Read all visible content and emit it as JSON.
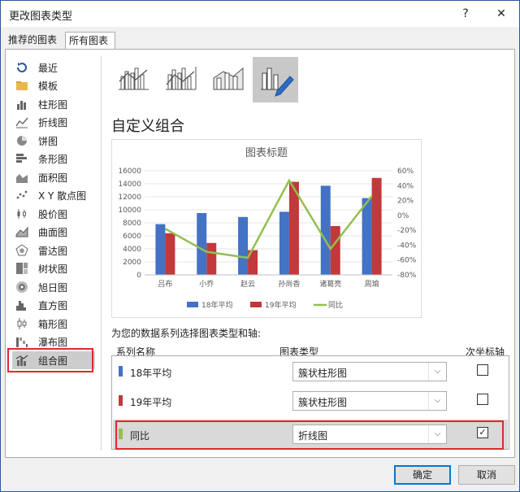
{
  "dialog": {
    "title": "更改图表类型",
    "help": "?",
    "close": "✕"
  },
  "tabs": [
    {
      "label": "推荐的图表"
    },
    {
      "label": "所有图表"
    }
  ],
  "sidebar": {
    "items": [
      {
        "label": "最近",
        "icon": "recent-icon"
      },
      {
        "label": "模板",
        "icon": "folder-icon"
      },
      {
        "label": "柱形图",
        "icon": "column-chart-icon"
      },
      {
        "label": "折线图",
        "icon": "line-chart-icon"
      },
      {
        "label": "饼图",
        "icon": "pie-chart-icon"
      },
      {
        "label": "条形图",
        "icon": "bar-chart-icon"
      },
      {
        "label": "面积图",
        "icon": "area-chart-icon"
      },
      {
        "label": "X Y 散点图",
        "icon": "scatter-chart-icon"
      },
      {
        "label": "股价图",
        "icon": "stock-chart-icon"
      },
      {
        "label": "曲面图",
        "icon": "surface-chart-icon"
      },
      {
        "label": "雷达图",
        "icon": "radar-chart-icon"
      },
      {
        "label": "树状图",
        "icon": "treemap-chart-icon"
      },
      {
        "label": "旭日图",
        "icon": "sunburst-chart-icon"
      },
      {
        "label": "直方图",
        "icon": "histogram-chart-icon"
      },
      {
        "label": "箱形图",
        "icon": "boxplot-chart-icon"
      },
      {
        "label": "瀑布图",
        "icon": "waterfall-chart-icon"
      },
      {
        "label": "组合图",
        "icon": "combo-chart-icon"
      }
    ],
    "selected": "组合图"
  },
  "section_title": "自定义组合",
  "chart_data": {
    "type": "bar",
    "title": "图表标题",
    "categories": [
      "吕布",
      "小乔",
      "赵云",
      "孙尚香",
      "诸葛亮",
      "周瑜"
    ],
    "series": [
      {
        "name": "18年平均",
        "type": "bar",
        "axis": "primary",
        "color": "#4472c4",
        "values": [
          7800,
          9500,
          8900,
          9700,
          13700,
          11800
        ]
      },
      {
        "name": "19年平均",
        "type": "bar",
        "axis": "primary",
        "color": "#c0393b",
        "values": [
          6400,
          4900,
          3800,
          14300,
          7500,
          14900
        ]
      },
      {
        "name": "同比",
        "type": "line",
        "axis": "secondary",
        "color": "#92c050",
        "values": [
          -18,
          -49,
          -57,
          47,
          -45,
          26
        ]
      }
    ],
    "y_primary": {
      "min": 0,
      "max": 16000,
      "ticks": [
        "0",
        "2000",
        "4000",
        "6000",
        "8000",
        "10000",
        "12000",
        "14000",
        "16000"
      ]
    },
    "y_secondary": {
      "min": -80,
      "max": 60,
      "ticks": [
        "-80%",
        "-60%",
        "-40%",
        "-20%",
        "0%",
        "20%",
        "40%",
        "60%"
      ]
    },
    "legend": "bottom",
    "grid": true
  },
  "instruction": "为您的数据系列选择图表类型和轴:",
  "grid_headers": {
    "name": "系列名称",
    "type": "图表类型",
    "axis": "次坐标轴"
  },
  "series_rows": [
    {
      "name": "18年平均",
      "color": "#4472c4",
      "chart_type": "簇状柱形图",
      "secondary": false
    },
    {
      "name": "19年平均",
      "color": "#c0393b",
      "chart_type": "簇状柱形图",
      "secondary": false
    },
    {
      "name": "同比",
      "color": "#92c050",
      "chart_type": "折线图",
      "secondary": true,
      "check": "✓"
    }
  ],
  "buttons": {
    "ok": "确定",
    "cancel": "取消"
  },
  "colors": {
    "highlight": "#e0282e",
    "accent": "#0078d7"
  }
}
